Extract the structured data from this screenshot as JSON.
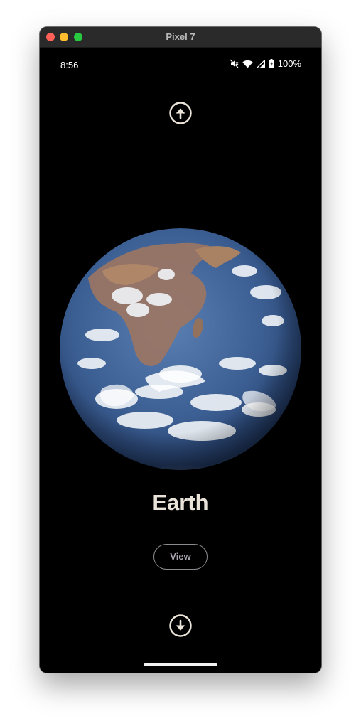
{
  "window": {
    "title": "Pixel 7"
  },
  "status_bar": {
    "time": "8:56",
    "battery": "100%",
    "icons": [
      "mute-icon",
      "wifi-icon",
      "signal-icon",
      "battery-icon"
    ]
  },
  "navigation": {
    "up_icon": "arrow-up-circle-icon",
    "down_icon": "arrow-down-circle-icon"
  },
  "planet": {
    "name": "Earth",
    "image": "earth-globe"
  },
  "actions": {
    "view_label": "View"
  },
  "colors": {
    "background": "#000000",
    "title_text": "#e8e2d8",
    "button_border": "#8d8a8f",
    "button_text": "#aaa6b1",
    "icon_stroke": "#ece5da"
  }
}
